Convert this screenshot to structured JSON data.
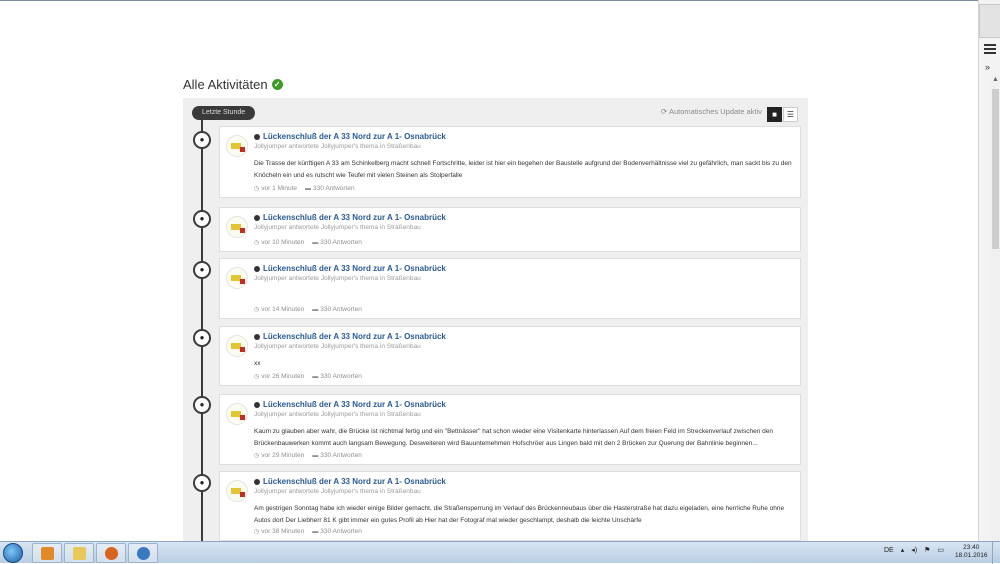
{
  "page": {
    "title": "Alle Aktivitäten"
  },
  "stream": {
    "period_badge": "Letzte Stunde",
    "auto_update": "Automatisches Update aktiv"
  },
  "items": [
    {
      "title": "Lückenschluß der A 33 Nord zur A 1- Osnabrück",
      "sub": "Jollyjumper antwortete Jollyjumper's thema in Straßenbau",
      "text": "Die Trasse der künftigen A 33 am Schinkelberg macht schnell Fortschritte, leider ist hier ein begehen der Baustelle aufgrund der Bodenverhältnisse viel zu gefährlich, man sackt bis zu den Knöcheln ein und es rutscht wie Teufel mit vielen Steinen als Stolperfalle",
      "time": "vor 1 Minute",
      "replies": "330 Antworten"
    },
    {
      "title": "Lückenschluß der A 33 Nord zur A 1- Osnabrück",
      "sub": "Jollyjumper antwortete Jollyjumper's thema in Straßenbau",
      "text": "",
      "time": "vor 10 Minuten",
      "replies": "330 Antworten"
    },
    {
      "title": "Lückenschluß der A 33 Nord zur A 1- Osnabrück",
      "sub": "Jollyjumper antwortete Jollyjumper's thema in Straßenbau",
      "text": "",
      "time": "vor 14 Minuten",
      "replies": "330 Antworten"
    },
    {
      "title": "Lückenschluß der A 33 Nord zur A 1- Osnabrück",
      "sub": "Jollyjumper antwortete Jollyjumper's thema in Straßenbau",
      "text": "xx",
      "time": "vor 26 Minuten",
      "replies": "330 Antworten"
    },
    {
      "title": "Lückenschluß der A 33 Nord zur A 1- Osnabrück",
      "sub": "Jollyjumper antwortete Jollyjumper's thema in Straßenbau",
      "text": "Kaum zu glauben aber wahr, die Brücke ist nichtmal fertig und ein \"Bettnässer\" hat schon wieder eine Visitenkarte hinterlassen Auf dem freien Feld im Streckenverlauf zwischen den Brückenbauwerken kommt auch langsam Bewegung. Desweiteren wird Bauuntemehmen Hofschröer aus Lingen bald mit den 2 Brücken zur Querung der Bahnlinie beginnen...",
      "time": "vor 29 Minuten",
      "replies": "330 Antworten"
    },
    {
      "title": "Lückenschluß der A 33 Nord zur A 1- Osnabrück",
      "sub": "Jollyjumper antwortete Jollyjumper's thema in Straßenbau",
      "text": "Am gestrigen Sonntag habe ich wieder einige Bilder gemacht, die Straßensperrung im Verlauf des Brückenneubaus über die Hasterstraße hat dazu eigeladen, eine herrliche Ruhe ohne Autos dort Der Liebherr 81 K gibt immer ein gutes Profil ab Hier hat der Fotograf mal wieder geschlampt, deshalb die leichte Unschärfe",
      "time": "vor 38 Minuten",
      "replies": "330 Antworten"
    }
  ],
  "taskbar": {
    "language": "DE",
    "time": "23:40",
    "date": "18.01.2016"
  },
  "colors": {
    "accent": "#2b5a93",
    "timeline": "#3a3a3a",
    "check": "#3c9a26"
  }
}
